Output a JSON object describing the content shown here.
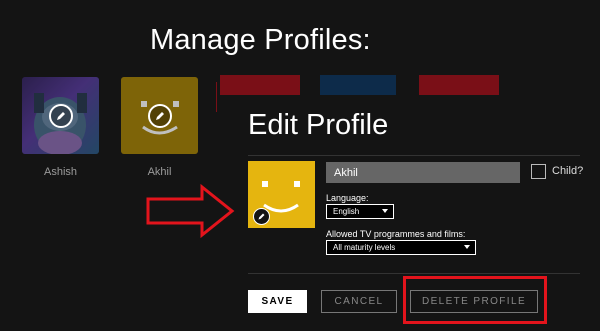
{
  "page": {
    "title": "Manage Profiles:"
  },
  "profiles": [
    {
      "name": "Ashish"
    },
    {
      "name": "Akhil"
    }
  ],
  "edit_profile": {
    "title": "Edit Profile",
    "name_value": "Akhil",
    "child_label": "Child?",
    "language_label": "Language:",
    "language_value": "English",
    "maturity_label": "Allowed TV programmes and films:",
    "maturity_value": "All maturity levels",
    "save_label": "SAVE",
    "cancel_label": "CANCEL",
    "delete_label": "DELETE PROFILE"
  },
  "colors": {
    "background": "#141414",
    "annotation_red": "#e3141c",
    "avatar_yellow": "#e5b50f",
    "input_gray": "#666666"
  },
  "icons": [
    "pencil-icon",
    "smiley-avatar-icon",
    "right-arrow-annotation-icon"
  ]
}
